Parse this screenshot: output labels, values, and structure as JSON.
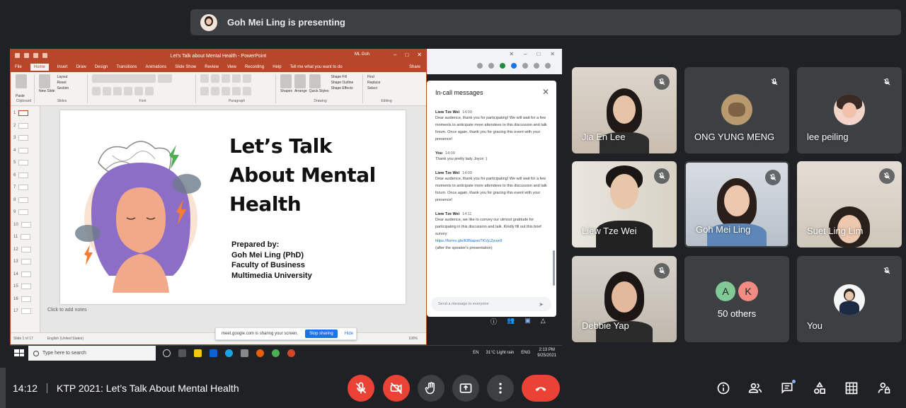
{
  "banner": {
    "text": "Goh Mei Ling is presenting"
  },
  "powerpoint": {
    "window_title": "Let's Talk about Mental Health  -  PowerPoint",
    "user": "ML Goh",
    "tabs": [
      "File",
      "Home",
      "Insert",
      "Draw",
      "Design",
      "Transitions",
      "Animations",
      "Slide Show",
      "Review",
      "View",
      "Recording",
      "Help",
      "Tell me what you want to do"
    ],
    "share_label": "Share",
    "ribbon_groups": [
      "Clipboard",
      "Slides",
      "Font",
      "Paragraph",
      "Drawing",
      "Editing"
    ],
    "ribbon_items": {
      "paste": "Paste",
      "new_slide": "New Slide",
      "layout": "Layout",
      "reset": "Reset",
      "section": "Section",
      "shapes": "Shapes",
      "arrange": "Arrange",
      "quick_styles": "Quick Styles",
      "shape_fill": "Shape Fill",
      "shape_outline": "Shape Outline",
      "shape_effects": "Shape Effects",
      "find": "Find",
      "replace": "Replace",
      "select": "Select"
    },
    "slide_numbers": [
      "1",
      "2",
      "3",
      "4",
      "5",
      "6",
      "7",
      "8",
      "9",
      "10",
      "11",
      "12",
      "13",
      "14",
      "15",
      "16",
      "17"
    ],
    "slide": {
      "title": "Let’s Talk\nAbout Mental\nHealth",
      "prepared_by": "Prepared by:",
      "presenter": "Goh Mei Ling (PhD)",
      "faculty": "Faculty of Business",
      "university": "Multimedia University"
    },
    "notes_placeholder": "Click to add notes",
    "status_slide": "Slide 1 of 17",
    "status_lang": "English (United States)",
    "status_zoom": "100%"
  },
  "share_toast": {
    "text": "meet.google.com is sharing your screen.",
    "stop": "Stop sharing",
    "hide": "Hide"
  },
  "chat": {
    "title": "In-call messages",
    "messages": [
      {
        "who": "Liew Tze Wei",
        "time": "14:09",
        "text": "Dear audience, thank you for participating! We will wait for a few moments to anticipate more attendees to this discussion and talk forum. Once again, thank you for gracing this event with your presence!"
      },
      {
        "who": "You",
        "time": "14:09",
        "text": "Thank you pretty lady Joyce :)"
      },
      {
        "who": "Liew Tze Wei",
        "time": "14:09",
        "text": "Dear audience, thank you for participating! We will wait for a few moments to anticipate more attendees to this discussion and talk forum. Once again, thank you for gracing this event with your presence!"
      },
      {
        "who": "Liew Tze Wei",
        "time": "14:11",
        "text": "Dear audience, we like to convey our utmost gratitude for participating in this discussion and talk. Kindly fill out this brief survey:",
        "link": "https://forms.gle/K8NapsnTKVjcZpuw9",
        "after": "(after the speaker's presentation)"
      }
    ],
    "input_placeholder": "Send a message to everyone"
  },
  "taskbar": {
    "search_placeholder": "Type here to search",
    "weather": "31°C  Light rain",
    "lang": "ENG",
    "time": "2:13 PM",
    "date": "9/25/2021",
    "en": "EN"
  },
  "participants": [
    {
      "name": "Jia En Lee"
    },
    {
      "name": "ONG YUNG MENG"
    },
    {
      "name": "lee peiling"
    },
    {
      "name": "Liew Tze Wei"
    },
    {
      "name": "Goh Mei Ling"
    },
    {
      "name": "Suet Ling Lim"
    },
    {
      "name": "Debbie Yap"
    },
    {
      "name": "50 others",
      "initials": [
        "A",
        "K"
      ]
    },
    {
      "name": "You"
    }
  ],
  "bottom_bar": {
    "time": "14:12",
    "meeting_title": "KTP 2021: Let’s Talk About Mental Health"
  },
  "colors": {
    "background": "#202124",
    "tile": "#3c4043",
    "danger": "#ea4335",
    "accent": "#8ab4f8",
    "ppt_brand": "#b7472a"
  }
}
